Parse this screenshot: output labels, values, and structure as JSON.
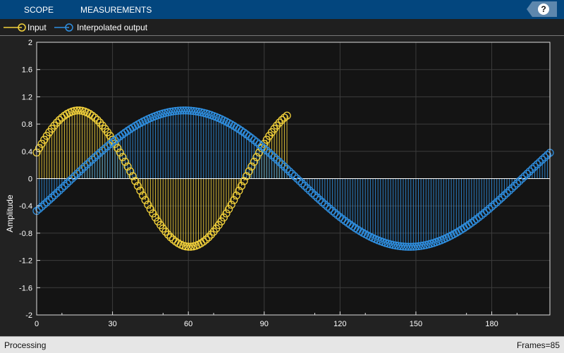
{
  "header": {
    "tabs": [
      "SCOPE",
      "MEASUREMENTS"
    ],
    "help_label": "?"
  },
  "status": {
    "left": "Processing",
    "right": "Frames=85"
  },
  "chart_data": {
    "type": "stem",
    "ylabel": "Amplitude",
    "xlabel": "",
    "xlim": [
      0,
      203
    ],
    "ylim": [
      -2,
      2
    ],
    "xticks": [
      0,
      30,
      60,
      90,
      120,
      150,
      180
    ],
    "yticks": [
      -2,
      -1.6,
      -1.2,
      -0.8,
      -0.4,
      0,
      0.4,
      0.8,
      1.2,
      1.6,
      2
    ],
    "grid": true,
    "legend": "top-left",
    "series": [
      {
        "name": "Input",
        "color": "#f2d13b",
        "n_start": 0,
        "n_end": 99,
        "step": 1,
        "amplitude": 1,
        "period": 88,
        "phase_shift": 5.5
      },
      {
        "name": "Interpolated output",
        "color": "#2f8fe0",
        "n_start": 0,
        "n_end": 203,
        "step": 1,
        "amplitude": 1,
        "period": 178,
        "phase_shift": -14
      }
    ]
  }
}
